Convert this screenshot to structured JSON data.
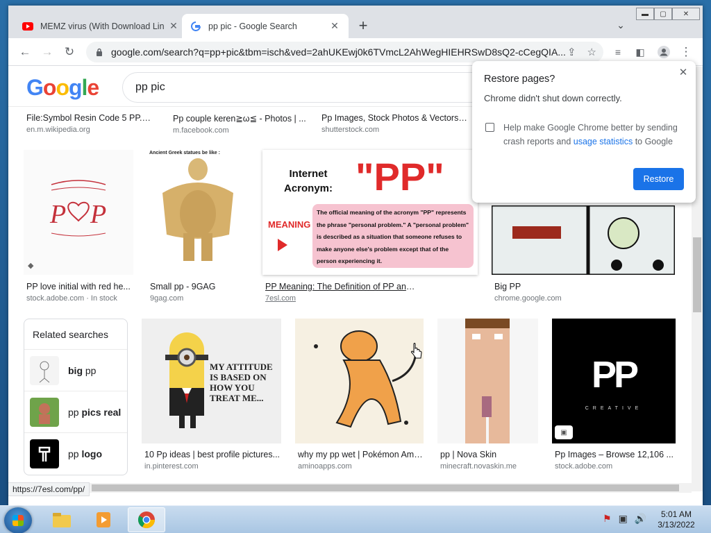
{
  "tabs": [
    {
      "title": "MEMZ virus (With Download Lin",
      "icon": "youtube-icon"
    },
    {
      "title": "pp pic - Google Search",
      "icon": "google-icon"
    }
  ],
  "omnibox": {
    "url": "google.com/search?q=pp+pic&tbm=isch&ved=2ahUKEwj0k6TVmcL2AhWegHIEHRSwD8sQ2-cCegQIA..."
  },
  "google": {
    "logo": "Google",
    "query": "pp pic"
  },
  "results_row0": [
    {
      "title": "File:Symbol Resin Code 5 PP.sv...",
      "source": "en.m.wikipedia.org"
    },
    {
      "title": "Pp couple keren≧ω≦ - Photos | ...",
      "source": "m.facebook.com"
    },
    {
      "title": "Pp Images, Stock Photos & Vectors ...",
      "source": "shutterstock.com"
    }
  ],
  "results_row1": [
    {
      "title": "PP love initial with red he...",
      "source": "stock.adobe.com · In stock"
    },
    {
      "title": "Small pp - 9GAG",
      "source": "9gag.com",
      "caption": "Ancient Greek statues be like :"
    },
    {
      "title": "PP Meaning: The Definition of PP and...",
      "source": "7esl.com",
      "heading": "Internet Acronym:",
      "big": "\"PP\"",
      "meaning": "MEANING",
      "body": "The official meaning of the acronym \"PP\" represents the phrase \"personal problem.\" A \"personal problem\" is described as a situation that someone refuses to make anyone else's problem except that of the person experiencing it."
    },
    {
      "title": "Big PP",
      "source": "chrome.google.com"
    }
  ],
  "related": {
    "heading": "Related searches",
    "items": [
      {
        "prefix": "big",
        "suffix": " pp",
        "bold_first": true
      },
      {
        "prefix": "pp ",
        "suffix": "pics real",
        "bold_first": false
      },
      {
        "prefix": "pp ",
        "suffix": "logo",
        "bold_first": false
      }
    ]
  },
  "results_row2": [
    {
      "title": "10 Pp ideas | best profile pictures...",
      "source": "in.pinterest.com",
      "caption": "MY ATTITUDE IS BASED ON HOW YOU TREAT ME..."
    },
    {
      "title": "why my pp wet | Pokémon Ami...",
      "source": "aminoapps.com"
    },
    {
      "title": "pp | Nova Skin",
      "source": "minecraft.novaskin.me"
    },
    {
      "title": "Pp Images – Browse 12,106 ...",
      "source": "stock.adobe.com",
      "logo": "PP",
      "logo_sub": "CREATIVE"
    }
  ],
  "status_url": "https://7esl.com/pp/",
  "popup": {
    "title": "Restore pages?",
    "body": "Chrome didn't shut down correctly.",
    "checkbox_pre": "Help make Google Chrome better by sending crash reports and ",
    "checkbox_link": "usage statistics",
    "checkbox_post": " to Google",
    "button": "Restore"
  },
  "clock": {
    "time": "5:01 AM",
    "date": "3/13/2022"
  },
  "colors": {
    "google_blue": "#4285f4",
    "google_red": "#ea4335",
    "google_yellow": "#fbbc05",
    "google_green": "#34a853",
    "chrome_blue": "#1a73e8"
  }
}
